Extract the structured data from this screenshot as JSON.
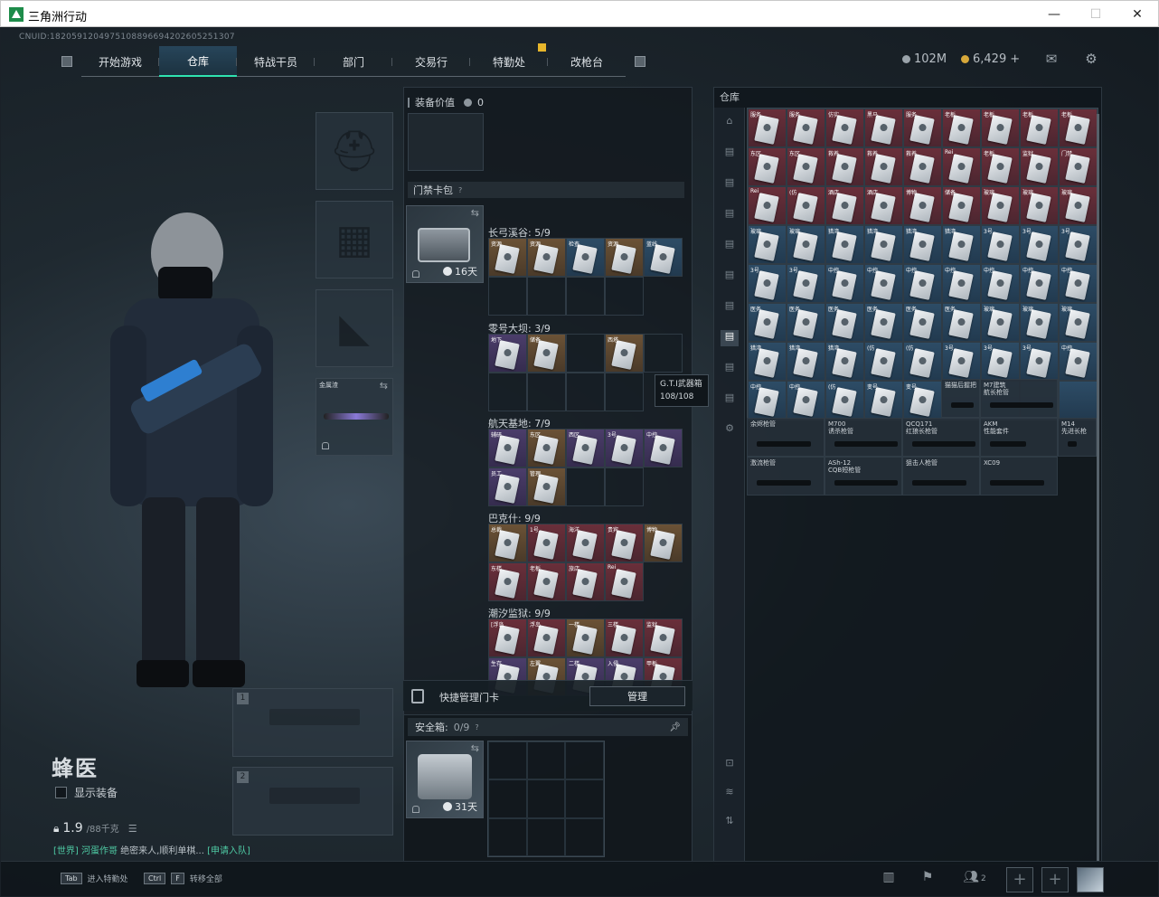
{
  "window": {
    "title": "三角洲行动",
    "min": "—",
    "max": "☐",
    "close": "✕"
  },
  "uid": "CNUID:1820591204975108896694202605251307",
  "nav": {
    "tabs": [
      "开始游戏",
      "仓库",
      "特战干员",
      "部门",
      "交易行",
      "特勤处",
      "改枪台"
    ],
    "active": 1
  },
  "currency": {
    "silver": "102M",
    "gold": "6,429",
    "gold_plus": "+"
  },
  "character": {
    "name": "蜂医",
    "show_equip": "显示装备",
    "weight": "1.9",
    "weight_max": "/88千克"
  },
  "chat": {
    "channel": "[世界]",
    "user": "河蛋作哥",
    "message": "绝密来人,顺利单棋...",
    "join": "[申请入队]"
  },
  "rig_slot": {
    "label": "金属渣"
  },
  "equip_value": {
    "label": "装备价值",
    "value": "0"
  },
  "keycard_bag": {
    "title": "门禁卡包",
    "days": "16天"
  },
  "maps": [
    {
      "name": "长弓溪谷: 5/9",
      "cards": [
        [
          "资源",
          "gold"
        ],
        [
          "资源",
          "gold"
        ],
        [
          "检查",
          "blue"
        ],
        [
          "资源",
          "gold"
        ],
        [
          "蓝线",
          "blue"
        ]
      ],
      "empties": 4
    },
    {
      "name": "零号大坝: 3/9",
      "cards": [
        [
          "地下",
          "purple"
        ],
        [
          "储备",
          "gold"
        ],
        [
          "",
          ""
        ],
        [
          "西塔",
          "gold"
        ],
        [
          "",
          ""
        ]
      ],
      "empties": 4
    },
    {
      "name": "航天基地: 7/9",
      "cards": [
        [
          "辅研",
          "purple"
        ],
        [
          "东区",
          "gold"
        ],
        [
          "西区",
          "purple"
        ],
        [
          "3号",
          "purple"
        ],
        [
          "中控",
          "purple"
        ],
        [
          "员工",
          "purple"
        ],
        [
          "管理",
          "gold"
        ]
      ],
      "empties": 2
    },
    {
      "name": "巴克什: 9/9",
      "cards": [
        [
          "总裁",
          "gold"
        ],
        [
          "1号",
          "red"
        ],
        [
          "海洋",
          "red"
        ],
        [
          "贵宾",
          "red"
        ],
        [
          "博物",
          "gold"
        ],
        [
          "东楼",
          "red"
        ],
        [
          "老板",
          "red"
        ],
        [
          "旅店",
          "red"
        ],
        [
          "Rei",
          "red"
        ]
      ],
      "empties": 0
    },
    {
      "name": "潮汐监狱: 9/9",
      "cards": [
        [
          "[浮岛",
          "red"
        ],
        [
          "浮岛",
          "red"
        ],
        [
          "一楼",
          "gold"
        ],
        [
          "三楼",
          "red"
        ],
        [
          "监狱",
          "red"
        ],
        [
          "生存",
          "purple"
        ],
        [
          "左翼",
          "gold"
        ],
        [
          "二楼",
          "purple"
        ],
        [
          "入侵",
          "purple"
        ],
        [
          "甲板",
          "red"
        ]
      ],
      "empties": 0
    }
  ],
  "tooltip": {
    "name": "G.T.I武器箱",
    "count": "108/108"
  },
  "quick_card": {
    "label": "快捷管理门卡",
    "button": "管理"
  },
  "safe_box": {
    "label": "安全箱:",
    "count": "0/9",
    "days": "31天"
  },
  "weapon_slots": [
    {
      "n": "1"
    },
    {
      "n": "2"
    }
  ],
  "stash": {
    "title": "仓库",
    "rows": [
      [
        "服务",
        "服务",
        "仿实",
        "黑马",
        "服务",
        "老板",
        "老板",
        "老板",
        "老板"
      ],
      [
        "东区",
        "东区",
        "救养",
        "救养",
        "救养",
        "Rei",
        "老板",
        "监狱",
        "门禁"
      ],
      [
        "Rei",
        "(仿",
        "酒店",
        "酒店",
        "博物",
        "储备",
        "玻璃",
        "玻璃",
        "玻璃"
      ],
      [
        "玻璃",
        "玻璃",
        "猎湾",
        "猎湾",
        "猎湾",
        "猎湾",
        "3号",
        "3号",
        "3号"
      ],
      [
        "3号",
        "3号",
        "中控",
        "中控",
        "中控",
        "中控",
        "中控",
        "中控",
        "中控"
      ],
      [
        "医务",
        "医务",
        "医务",
        "医务",
        "医务",
        "医务",
        "玻璃",
        "玻璃",
        "玻璃"
      ],
      [
        "猎湾",
        "猎湾",
        "猎湾",
        "(仿",
        "(仿",
        "3号",
        "3号",
        "3号",
        "中控"
      ],
      [
        "中控",
        "中控",
        "(仿",
        "变号",
        "变号",
        "",
        "",
        "",
        ""
      ]
    ],
    "row_colors": [
      "red",
      "red",
      "red",
      "blue",
      "blue",
      "blue",
      "blue",
      "blue"
    ],
    "guns": [
      [
        "余烬枪管"
      ],
      [
        "M700",
        "诱杀枪管"
      ],
      [
        "QCQ171",
        "红狼长枪管"
      ],
      [
        "AKM",
        "性能套件"
      ],
      [
        "M14",
        "先进长枪"
      ],
      [
        "激流枪管"
      ],
      [
        "ASh-12",
        "CQB短枪管"
      ],
      [
        "狙击人枪管"
      ],
      [
        "XC09"
      ]
    ],
    "extra": [
      [
        "猫猫后握把"
      ],
      [
        "M7建筑",
        "航长枪管"
      ]
    ]
  },
  "bottom": {
    "tab_key": "Tab",
    "tab_text": "进入特勤处",
    "ctrl_key": "Ctrl",
    "f_key": "F",
    "ctrl_text": "转移全部",
    "friends": "2"
  }
}
